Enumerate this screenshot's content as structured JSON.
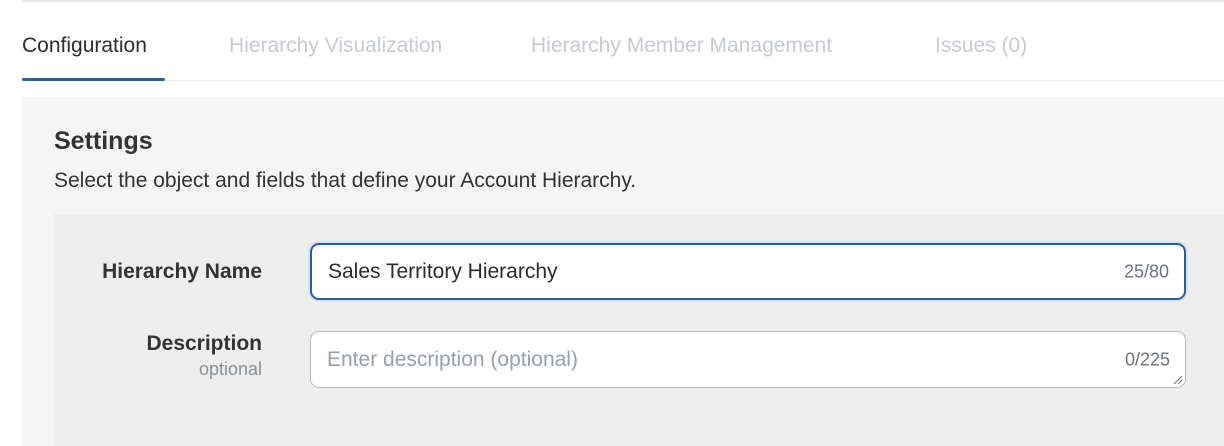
{
  "tabs": [
    {
      "label": "Configuration",
      "active": true
    },
    {
      "label": "Hierarchy Visualization",
      "active": false
    },
    {
      "label": "Hierarchy Member Management",
      "active": false
    },
    {
      "label": "Issues (0)",
      "active": false
    }
  ],
  "settings": {
    "title": "Settings",
    "subtitle": "Select the object and fields that define your Account Hierarchy."
  },
  "form": {
    "hierarchy_name": {
      "label": "Hierarchy Name",
      "value": "Sales Territory Hierarchy",
      "counter": "25/80"
    },
    "description": {
      "label": "Description",
      "sublabel": "optional",
      "placeholder": "Enter description (optional)",
      "value": "",
      "counter": "0/225"
    }
  },
  "colors": {
    "accent": "#2c5f92",
    "inactive_tab": "#c8cbcf",
    "panel_bg": "#f5f5f6",
    "form_bg": "#eeeeef"
  },
  "icons": {
    "resize_handle": "resize-handle-icon"
  }
}
